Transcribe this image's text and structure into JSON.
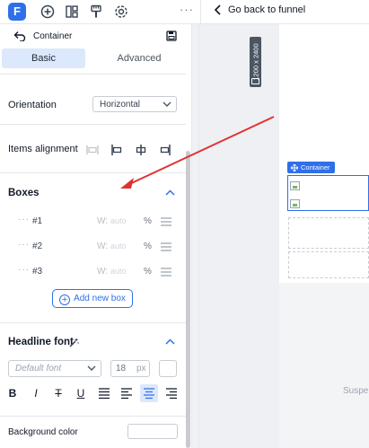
{
  "app": {
    "logo_letter": "F",
    "more": "···"
  },
  "topbar": {
    "back_label": "Go back to funnel"
  },
  "panel": {
    "title": "Container",
    "tabs": [
      {
        "label": "Basic"
      },
      {
        "label": "Advanced"
      }
    ],
    "orientation": {
      "label": "Orientation",
      "value": "Horizontal"
    },
    "items_alignment": {
      "label": "Items alignment"
    },
    "boxes": {
      "title": "Boxes",
      "rows": [
        {
          "name": "#1",
          "w_label": "W:",
          "placeholder": "auto",
          "unit": "%"
        },
        {
          "name": "#2",
          "w_label": "W:",
          "placeholder": "auto",
          "unit": "%"
        },
        {
          "name": "#3",
          "w_label": "W:",
          "placeholder": "auto",
          "unit": "%"
        }
      ],
      "add_label": "Add new box"
    },
    "headline_font": {
      "title": "Headline font",
      "font_placeholder": "Default font",
      "size": "18",
      "size_unit": "px"
    },
    "format_buttons": [
      "B",
      "I",
      "T",
      "U"
    ],
    "background_color": {
      "label": "Background color"
    }
  },
  "canvas": {
    "dimensions": "1200 x 2400",
    "container_tag": "Container",
    "partial_text": "Suspe"
  },
  "colors": {
    "accent": "#2f6fea",
    "annotation_arrow": "#e03131"
  }
}
